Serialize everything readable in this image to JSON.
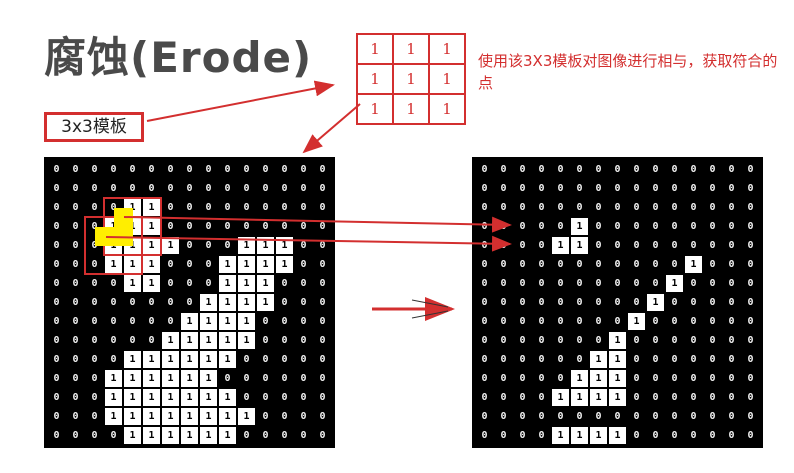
{
  "title": "腐蚀(Erode)",
  "template_label": "3x3模板",
  "kernel": [
    "1",
    "1",
    "1",
    "1",
    "1",
    "1",
    "1",
    "1",
    "1"
  ],
  "description": "使用该3X3模板对图像进行相与，获取符合的点",
  "colors": {
    "annotation_red": "#d32f2f",
    "highlight_yellow": "#ffee00",
    "cell_bg": "#000000",
    "cell_on": "#ffffff"
  },
  "source_grid": [
    "000000000000000",
    "000000000000000",
    "000011000000000",
    "000111000000000",
    "000111100011100",
    "000111000111100",
    "000011000111000",
    "000000001111000",
    "000000011110000",
    "000000111110000",
    "000011111100000",
    "000111111000000",
    "000111111100000",
    "000111111110000",
    "000011111100000"
  ],
  "result_grid": [
    "000000000000000",
    "000000000000000",
    "000000000000000",
    "000001000000000",
    "000011000000000",
    "000000000001000",
    "000000000010000",
    "000000000100000",
    "000000001000000",
    "000000010000000",
    "000000110000000",
    "000001110000000",
    "000011110000000",
    "000000000000000",
    "000011110000000"
  ]
}
